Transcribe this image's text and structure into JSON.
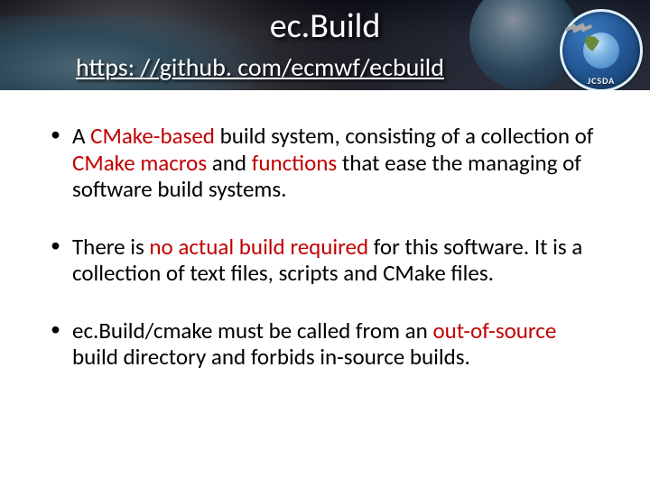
{
  "header": {
    "title": "ec.Build",
    "subtitle": "https: //github. com/ecmwf/ecbuild",
    "logo_text": "JCSDA"
  },
  "bullets": [
    {
      "pre": "A ",
      "hl1": "CMake-based",
      "mid1": " build system, consisting of a collection of ",
      "hl2": "CMake macros",
      "mid2": " and ",
      "hl3": "functions",
      "post": " that ease the managing of software build systems."
    },
    {
      "pre": "There is ",
      "hl1": "no actual build required",
      "post": " for this software. It is a collection of text files, scripts and CMake files."
    },
    {
      "pre": "ec.Build/cmake must be called from an ",
      "hl1": "out-of-source",
      "post": " build directory and forbids in-source builds."
    }
  ]
}
